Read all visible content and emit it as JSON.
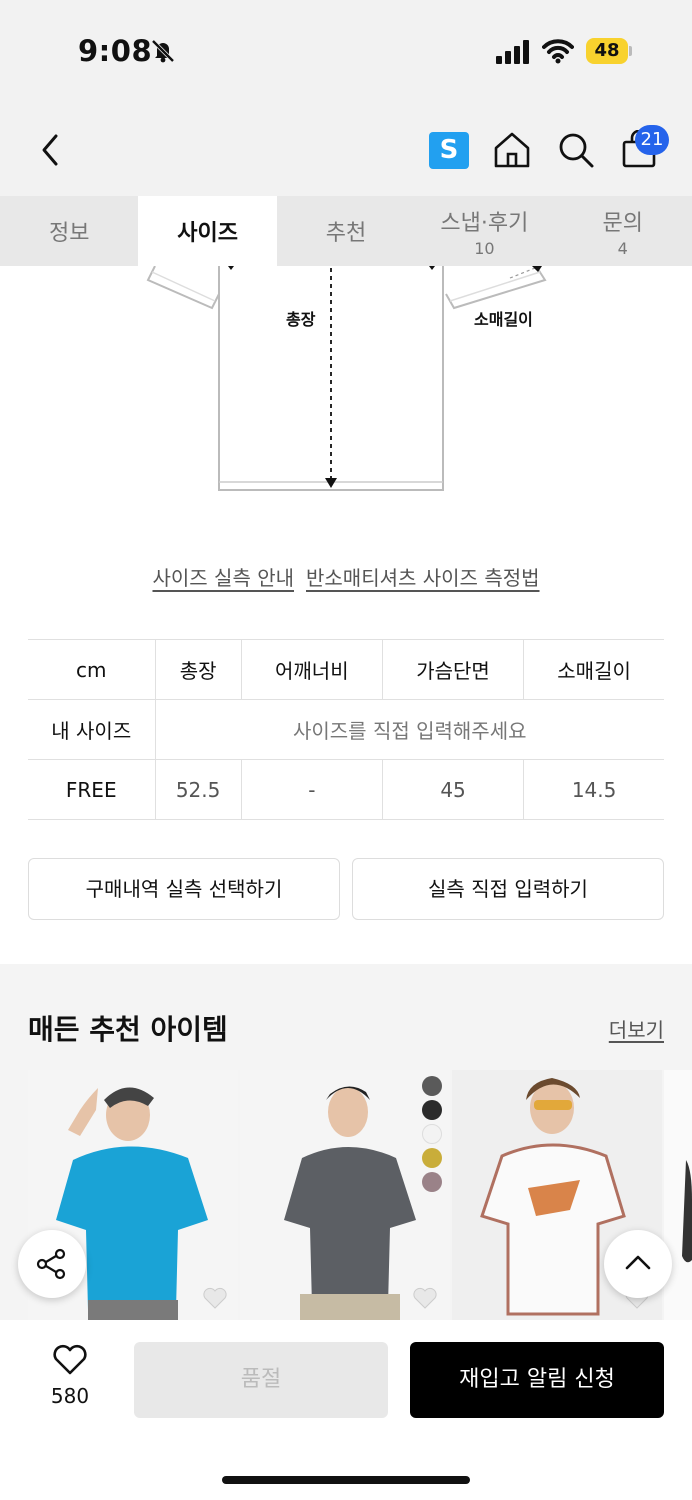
{
  "status_bar": {
    "time": "9:08",
    "battery": "48"
  },
  "nav": {
    "s_badge": "S",
    "cart_count": "21"
  },
  "tabs": [
    {
      "label": "정보",
      "count": ""
    },
    {
      "label": "사이즈",
      "count": ""
    },
    {
      "label": "추천",
      "count": ""
    },
    {
      "label": "스냅·후기",
      "count": "10"
    },
    {
      "label": "문의",
      "count": "4"
    }
  ],
  "diagram": {
    "length_label": "총장",
    "sleeve_label": "소매길이"
  },
  "links": {
    "guide": "사이즈 실측 안내",
    "method": "반소매티셔츠 사이즈 측정법"
  },
  "size_table": {
    "headers": [
      "cm",
      "총장",
      "어깨너비",
      "가슴단면",
      "소매길이"
    ],
    "my_size_label": "내 사이즈",
    "my_size_placeholder": "사이즈를 직접 입력해주세요",
    "rows": [
      {
        "size": "FREE",
        "values": [
          "52.5",
          "-",
          "45",
          "14.5"
        ]
      }
    ]
  },
  "buttons": {
    "purchase_history": "구매내역 실측 선택하기",
    "direct_input": "실측 직접 입력하기"
  },
  "recommend": {
    "title": "매든 추천 아이템",
    "more": "더보기"
  },
  "swatch_colors": [
    "#5a5a5a",
    "#2b2b2b",
    "#f3f3f3",
    "#c9ad3a",
    "#9a8288"
  ],
  "bottom": {
    "like_count": "580",
    "soldout": "품절",
    "notify": "재입고 알림 신청"
  }
}
